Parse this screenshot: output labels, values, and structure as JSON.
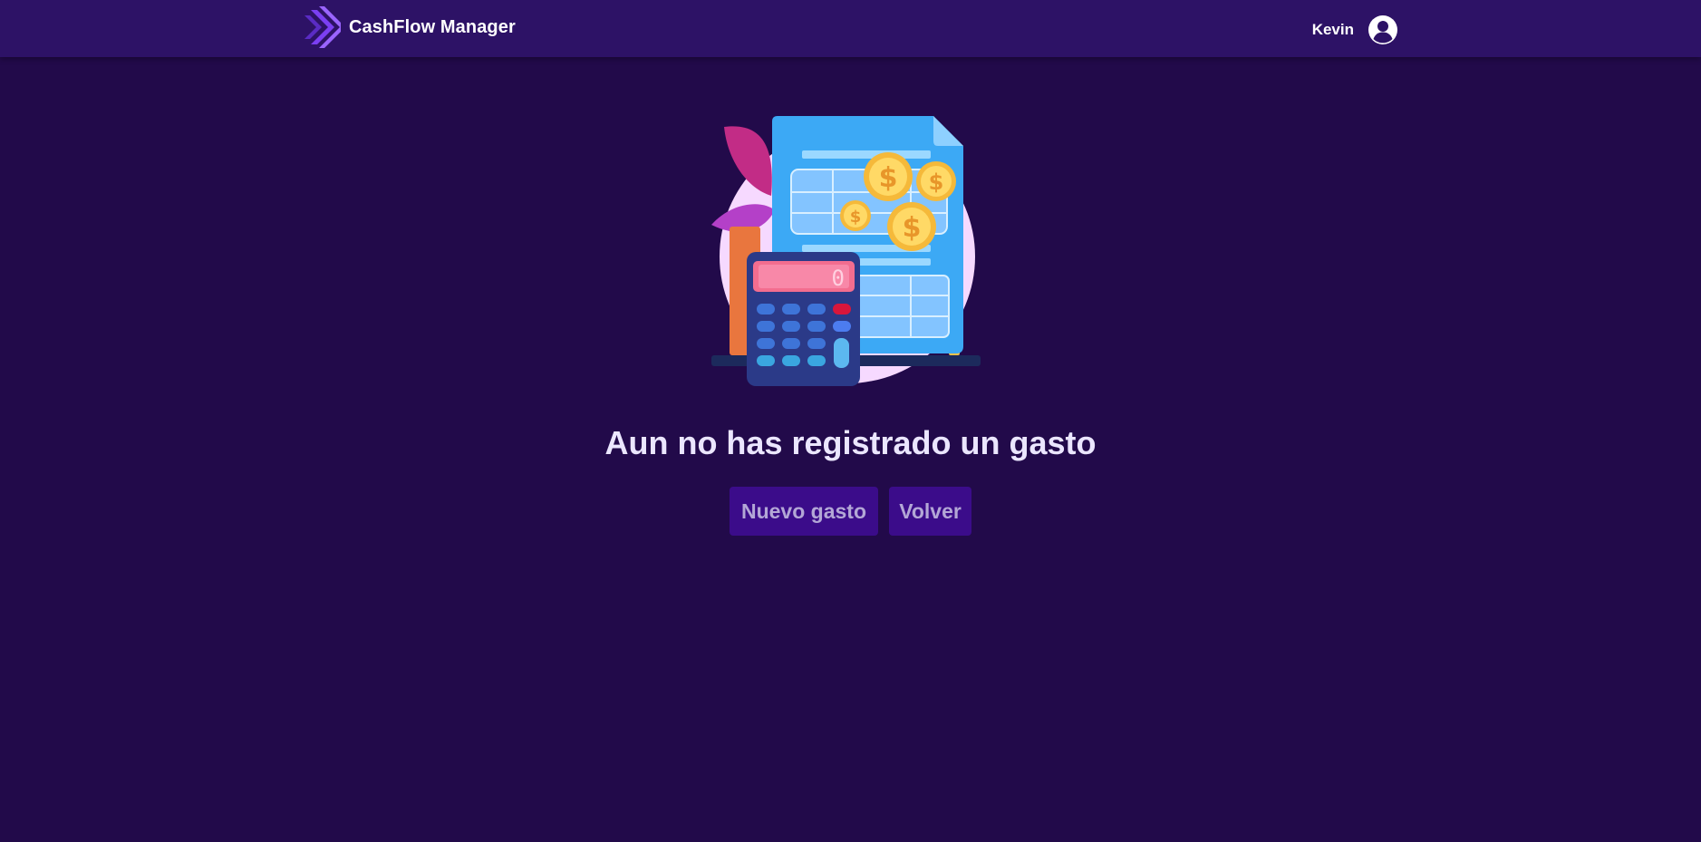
{
  "navbar": {
    "brand_name": "CashFlow Manager",
    "brand_icon": "chevrons-logo-icon",
    "user_name": "Kevin",
    "user_icon": "user-circle-icon"
  },
  "main": {
    "illustration": "calculator-invoice-coins-illustration",
    "calculator_display": "0",
    "empty_title": "Aun no has registrado un gasto",
    "new_expense_label": "Nuevo gasto",
    "back_label": "Volver"
  },
  "colors": {
    "background": "#220a4a",
    "navbar": "#2d1266",
    "button": "#3b0c8a",
    "button_text": "#b3a7d6",
    "title_text": "#ebe6ff",
    "accent": "#7b3ff2"
  }
}
